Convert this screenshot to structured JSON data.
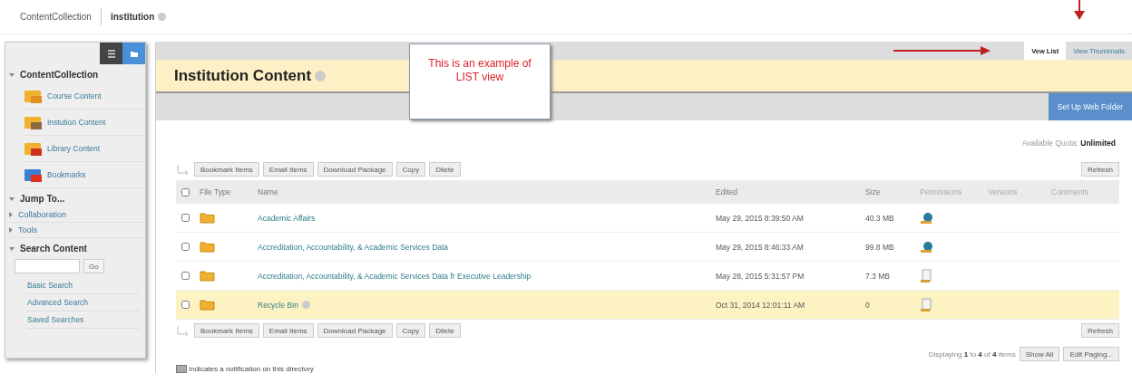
{
  "breadcrumbs": [
    {
      "label": "ContentCollection",
      "current": false
    },
    {
      "label": "institution",
      "current": true
    }
  ],
  "sidebar": {
    "view_toggle": [
      {
        "kind": "list",
        "selected": false
      },
      {
        "kind": "folder",
        "selected": true
      }
    ],
    "sections": [
      {
        "title": "ContentCollection",
        "expanded": true,
        "items": [
          {
            "label": "Course Content",
            "kind": "course"
          },
          {
            "label": "Instution Content",
            "kind": "institution"
          },
          {
            "label": "Library Content",
            "kind": "library"
          },
          {
            "label": "Bookmarks",
            "kind": "bookmarks"
          }
        ]
      },
      {
        "title": "Jump To...",
        "expanded": true,
        "children": [
          {
            "label": "Collaboration",
            "expanded": false
          },
          {
            "label": "Tools",
            "expanded": false
          }
        ]
      }
    ],
    "search": {
      "title": "Search Content",
      "expanded": true,
      "button": "Go",
      "links": [
        "Basic Search",
        "Advanced Search",
        "Saved Searches"
      ]
    }
  },
  "view_tabs": [
    {
      "label": "Vew List",
      "selected": true
    },
    {
      "label": "View Thumbnails",
      "selected": false
    }
  ],
  "page_title": "Institution Content",
  "callout": {
    "line1": "This is an example of",
    "line2": "LIST view"
  },
  "web_folder_button": "Set Up Web Folder",
  "quota": {
    "label": "Available Quota:",
    "value": "Unlimited"
  },
  "action_bar_top": {
    "buttons": [
      "Bookmark Items",
      "Email Items",
      "Download Package",
      "Copy",
      "Dilete"
    ],
    "refresh": "Refresh"
  },
  "table": {
    "select_all": {
      "checked": false
    },
    "columns": [
      "File Type",
      "Name",
      "Edited",
      "Size",
      "Permissions",
      "Versions",
      "Comments"
    ],
    "rows": [
      {
        "checked": false,
        "name": "Academic Affairs",
        "edited": "May 29, 2015 8:39:50 AM",
        "size": "40.3 MB",
        "permission": {
          "kind": "globe"
        },
        "highlighted": false,
        "menu": false
      },
      {
        "checked": false,
        "name": "Accreditation, Accountability, & Academic Services Data",
        "edited": "May 29, 2015 8:46:33 AM",
        "size": "99.8 MB",
        "permission": {
          "kind": "globe"
        },
        "highlighted": false,
        "menu": false
      },
      {
        "checked": false,
        "name": "Accreditation, Accountability, & Academic Services Data fr Executive Leadership",
        "edited": "May 28, 2015 5:31:57 PM",
        "size": "7.3 MB",
        "permission": {
          "kind": "document"
        },
        "highlighted": false,
        "menu": false
      },
      {
        "checked": false,
        "name": "Recycle Bin",
        "edited": "Oct 31, 2014 12:01:11 AM",
        "size": "0",
        "permission": {
          "kind": "document"
        },
        "highlighted": true,
        "menu": true
      }
    ]
  },
  "action_bar_bottom": {
    "buttons": [
      "Bookmark Items",
      "Email Items",
      "Download Package",
      "Copy",
      "Dilete"
    ],
    "refresh": "Refresh"
  },
  "paging": {
    "text": "Displaying **1** to **4** of **4** items",
    "buttons": [
      "Show All",
      "Edit Paging..."
    ]
  },
  "notice": "Indicates a notification on this directory"
}
